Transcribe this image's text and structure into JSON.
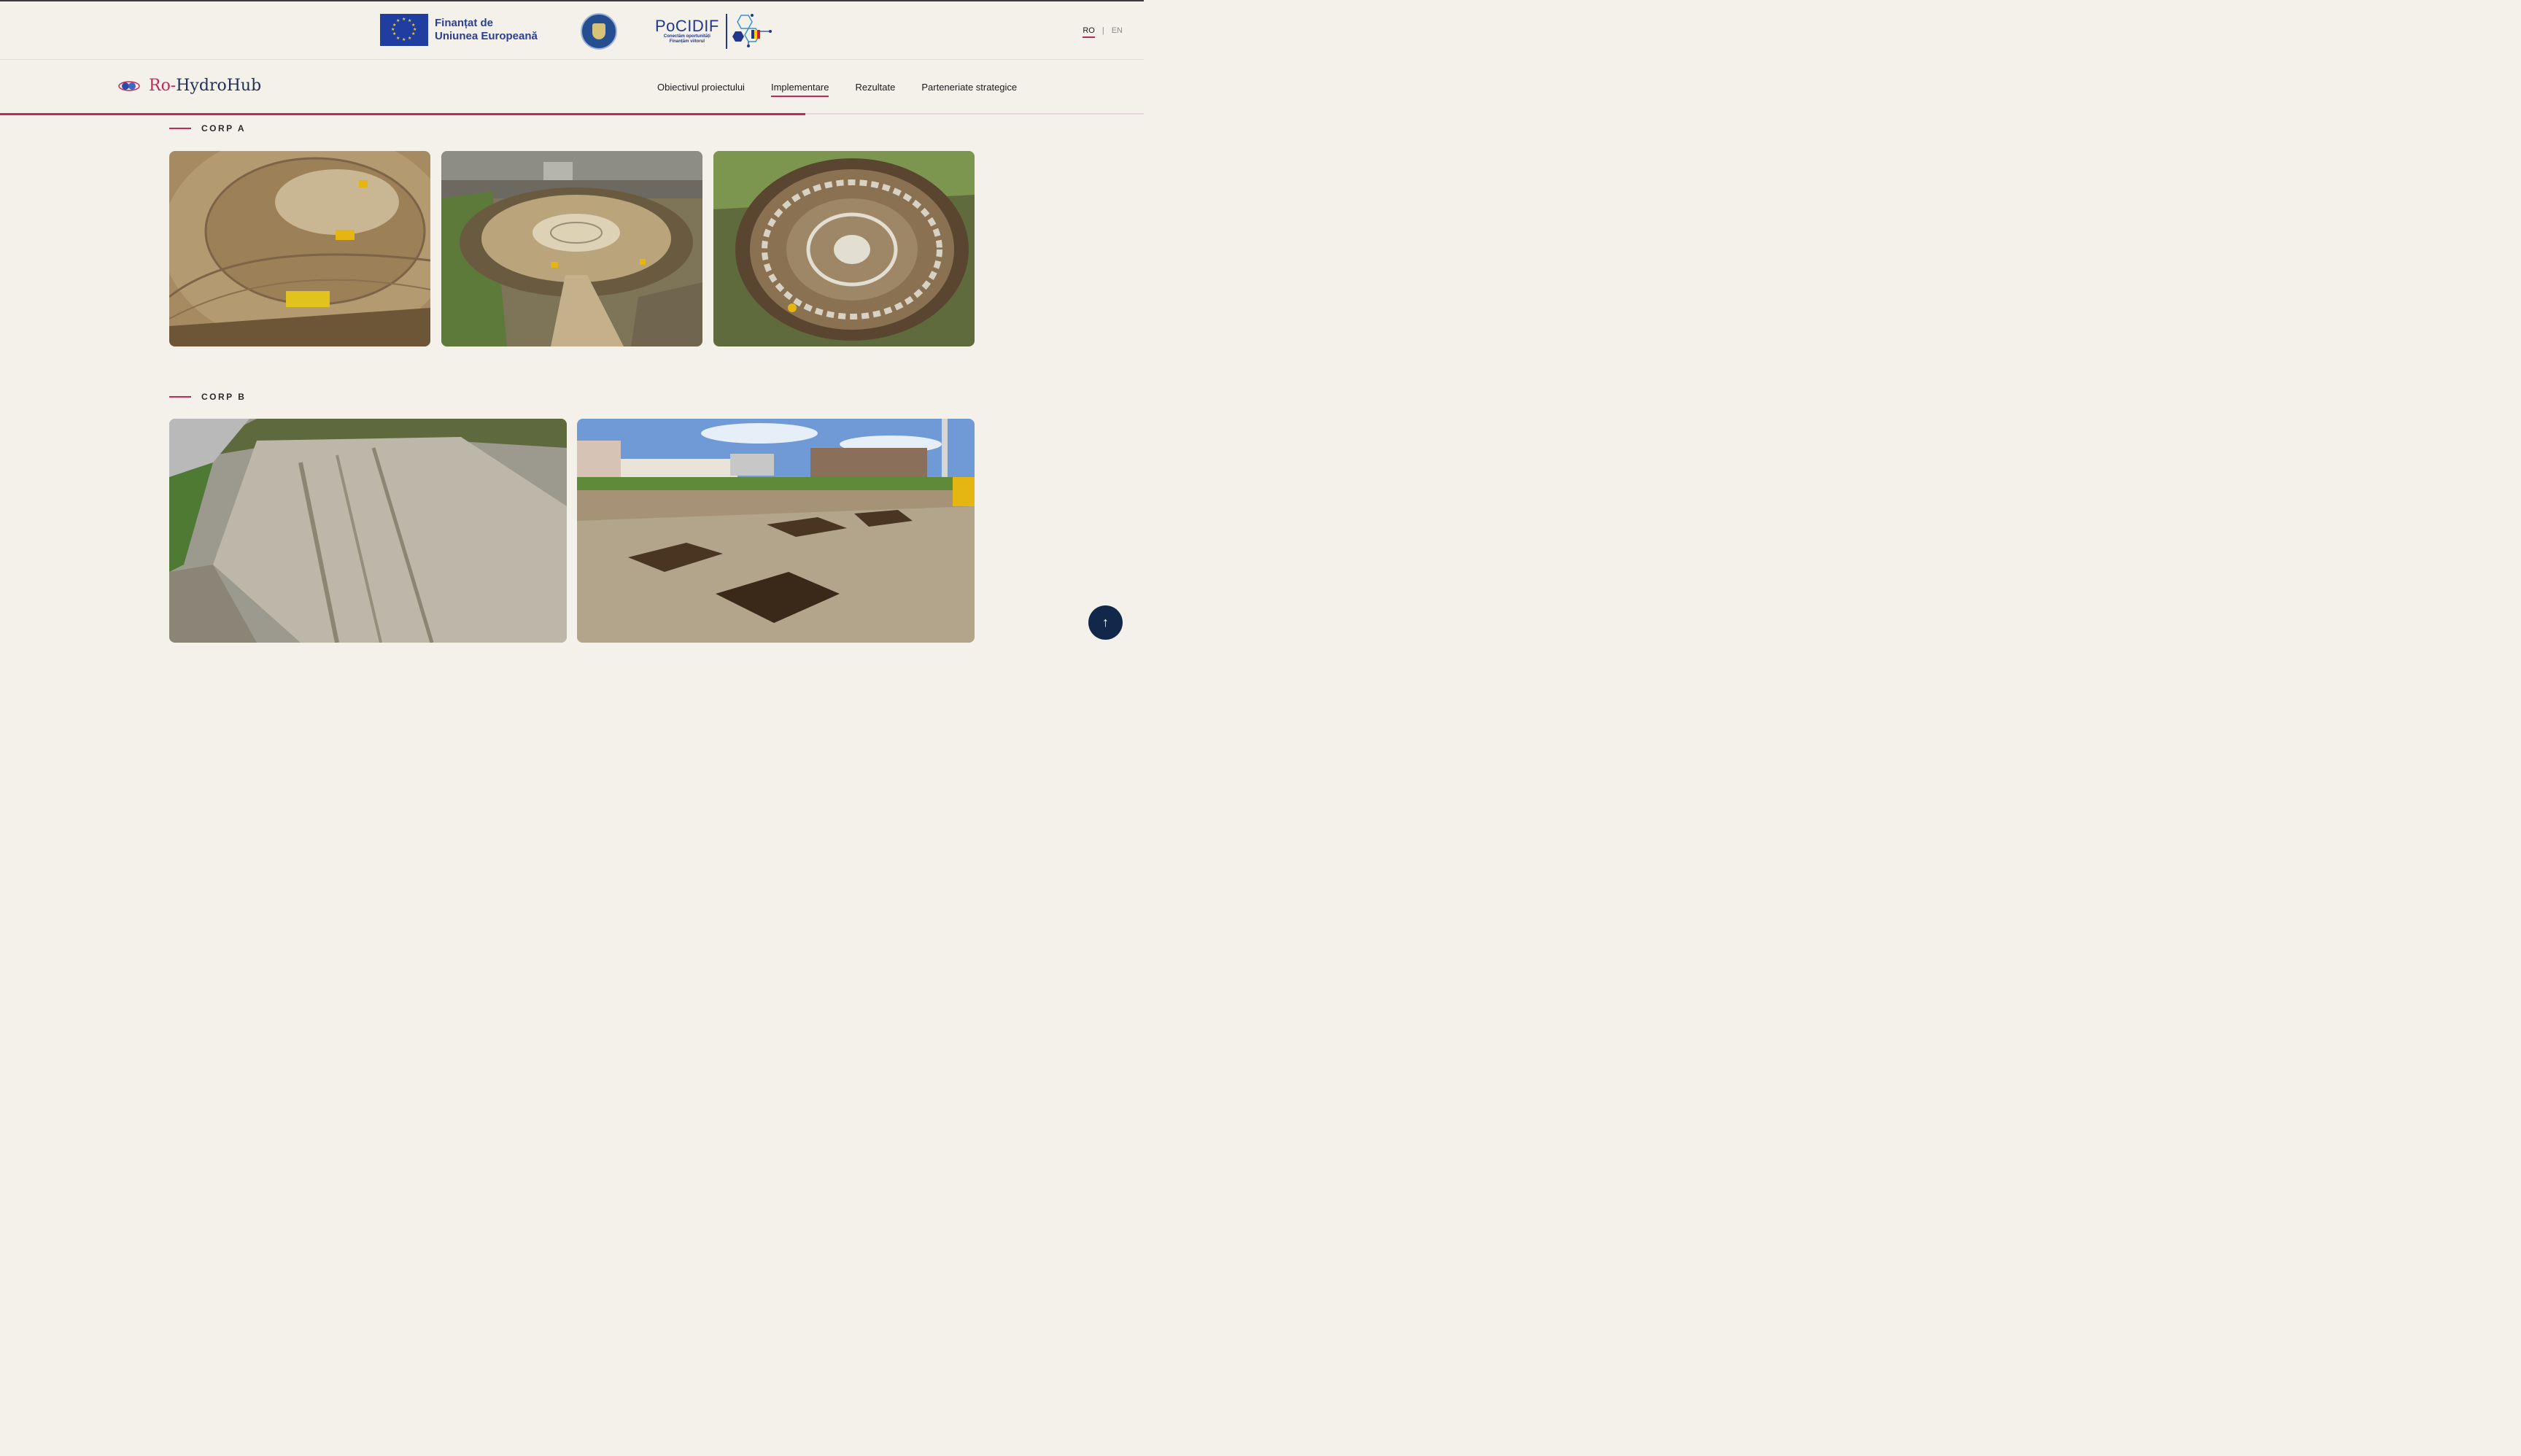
{
  "funding": {
    "eu_line1": "Finanțat de",
    "eu_line2": "Uniunea Europeană",
    "gov_label": "GUVERNUL ROMÂNIEI",
    "pocidif_name": "PoCIDIF",
    "pocidif_tag1": "Conectăm oportunități",
    "pocidif_tag2": "Finanțăm viitorul"
  },
  "lang": {
    "ro": "RO",
    "sep": "|",
    "en": "EN"
  },
  "brand": {
    "ro": "Ro-",
    "rest": "HydroHub"
  },
  "nav": {
    "items": [
      {
        "label": "Obiectivul proiectului"
      },
      {
        "label": "Implementare"
      },
      {
        "label": "Rezultate"
      },
      {
        "label": "Parteneriate strategice"
      }
    ]
  },
  "progress": {
    "fraction": 0.704
  },
  "sections": {
    "corp_a": {
      "title": "CORP A"
    },
    "corp_b": {
      "title": "CORP B"
    }
  },
  "back_to_top": {
    "icon": "arrow-up-icon",
    "glyph": "↑"
  },
  "colors": {
    "accent": "#c2295a",
    "navy": "#12284a",
    "bg": "#f3f1ea"
  }
}
